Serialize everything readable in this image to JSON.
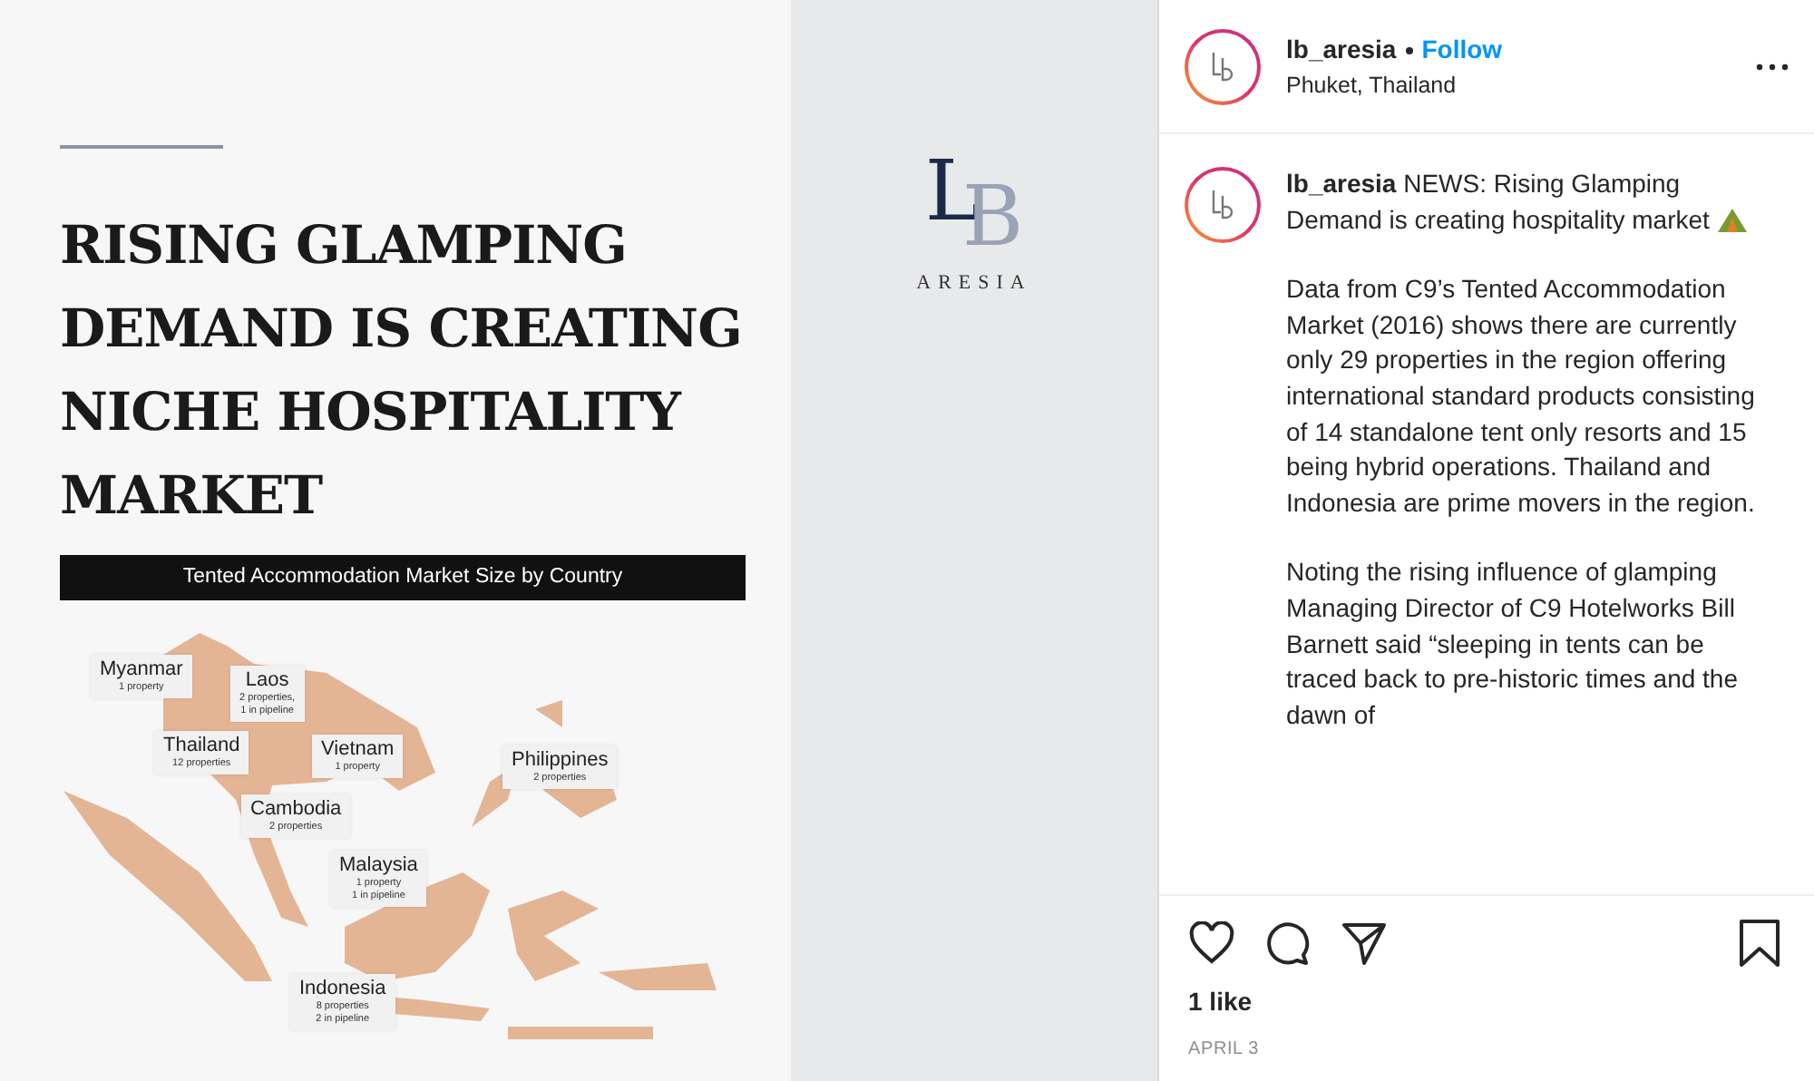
{
  "post_image": {
    "headline": [
      "RISING GLAMPING",
      "DEMAND IS CREATING",
      "NICHE HOSPITALITY",
      "MARKET"
    ],
    "map_title": "Tented Accommodation Market Size by Country",
    "map_labels": [
      {
        "country": "Myanmar",
        "detail": [
          "1 property"
        ]
      },
      {
        "country": "Laos",
        "detail": [
          "2 properties,",
          "1 in pipeline"
        ]
      },
      {
        "country": "Thailand",
        "detail": [
          "12 properties"
        ]
      },
      {
        "country": "Vietnam",
        "detail": [
          "1 property"
        ]
      },
      {
        "country": "Cambodia",
        "detail": [
          "2 properties"
        ]
      },
      {
        "country": "Philippines",
        "detail": [
          "2 properties"
        ]
      },
      {
        "country": "Malaysia",
        "detail": [
          "1 property",
          "1 in pipeline"
        ]
      },
      {
        "country": "Indonesia",
        "detail": [
          "8 properties",
          "2 in pipeline"
        ]
      }
    ],
    "logo": {
      "letters": [
        "L",
        "B"
      ],
      "brand": "ARESIA"
    }
  },
  "header": {
    "username": "lb_aresia",
    "follow": "Follow",
    "location": "Phuket, Thailand"
  },
  "caption": {
    "username": "lb_aresia",
    "paragraphs": [
      "NEWS: Rising Glamping Demand is creating hospitality market",
      "Data from C9’s Tented Accommodation Market (2016) shows there are currently only 29 properties in the region offering international standard products consisting of 14 standalone tent only resorts and 15 being hybrid operations. Thailand and Indonesia are prime movers in the region.",
      "Noting the rising influence of glamping Managing Director of C9 Hotelworks Bill Barnett said “sleeping in tents can be traced back to pre-historic times and the dawn of"
    ]
  },
  "likes": "1 like",
  "liked": false,
  "saved": false,
  "date": "APRIL 3"
}
